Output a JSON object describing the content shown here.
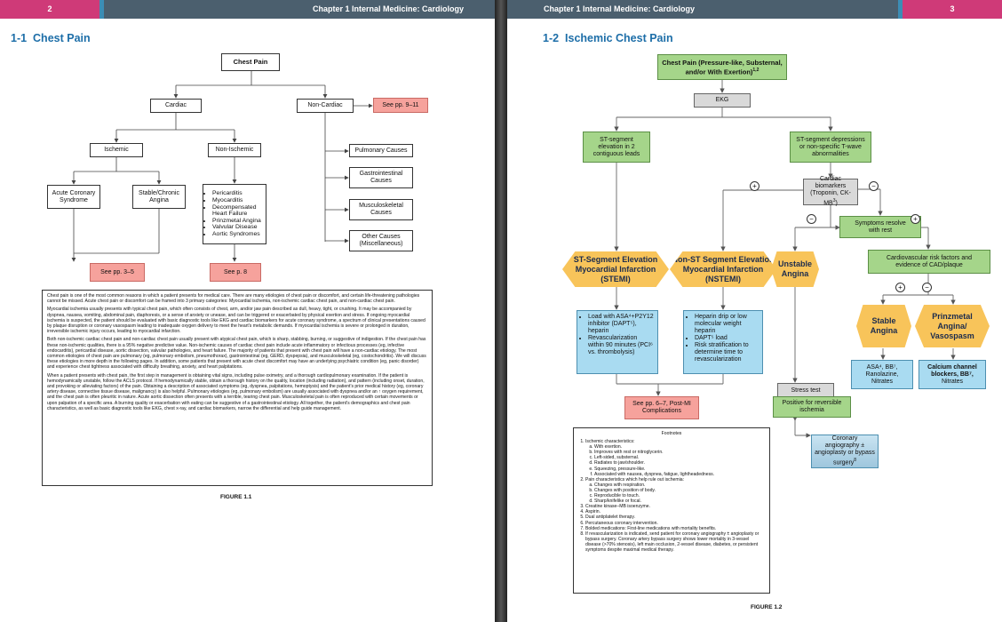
{
  "left_header": {
    "page_number": "2",
    "chapter": "Chapter 1  Internal Medicine: Cardiology"
  },
  "right_header": {
    "page_number": "3",
    "chapter": "Chapter 1  Internal Medicine: Cardiology"
  },
  "left": {
    "section_number": "1-1",
    "section_title": "Chest Pain",
    "nodes": {
      "chest_pain": "Chest Pain",
      "cardiac": "Cardiac",
      "non_cardiac": "Non-Cardiac",
      "see_9_11": "See pp. 9–11",
      "ischemic": "Ischemic",
      "non_ischemic": "Non-Ischemic",
      "acs": "Acute Coronary Syndrome",
      "stable_angina": "Stable/Chronic Angina",
      "non_ischemic_list": [
        "Pericarditis",
        "Myocarditis",
        "Decompensated Heart Failure",
        "Prinzmetal Angina",
        "Valvular Disease",
        "Aortic Syndromes"
      ],
      "pulmonary": "Pulmonary Causes",
      "gi": "Gastrointestinal Causes",
      "msk": "Musculoskeletal Causes",
      "other": "Other Causes (Miscellaneous)",
      "see_3_5": "See pp. 3–5",
      "see_8": "See p. 8"
    },
    "paragraphs": [
      "Chest pain is one of the most common reasons in which a patient presents for medical care. There are many etiologies of chest pain or discomfort, and certain life-threatening pathologies cannot be missed. Acute chest pain or discomfort can be framed into 3 primary categories: Myocardial ischemia, non-ischemic cardiac chest pain, and non-cardiac chest pain.",
      "Myocardial ischemia usually presents with typical chest pain, which often consists of chest, arm, and/or jaw pain described as dull, heavy, tight, or crushing. It may be accompanied by dyspnea, nausea, vomiting, abdominal pain, diaphoresis, or a sense of anxiety or unease, and can be triggered or exacerbated by physical exertion and stress. If ongoing myocardial ischemia is suspected, the patient should be evaluated with basic diagnostic tools like EKG and cardiac biomarkers for acute coronary syndrome, a spectrum of clinical presentations caused by plaque disruption or coronary vasospasm leading to inadequate oxygen delivery to meet the heart's metabolic demands. If myocardial ischemia is severe or prolonged in duration, irreversible ischemic injury occurs, leading to myocardial infarction.",
      "Both non-ischemic cardiac chest pain and non-cardiac chest pain usually present with atypical chest pain, which is sharp, stabbing, burning, or suggestive of indigestion. If the chest pain has these non-ischemic qualities, there is a 95% negative predictive value. Non-ischemic causes of cardiac chest pain include acute inflammatory or infectious processes (eg, infective endocarditis), pericardial disease, aortic dissection, valvular pathologies, and heart failure. The majority of patients that present with chest pain will have a non-cardiac etiology. The most common etiologies of chest pain are pulmonary (eg, pulmonary embolism, pneumothorax), gastrointestinal (eg, GERD, dyspepsia), and musculoskeletal (eg, costochondritis). We will discuss these etiologies in more depth in the following pages. In addition, some patients that present with acute chest discomfort may have an underlying psychiatric condition (eg, panic disorder) and experience chest tightness associated with difficulty breathing, anxiety, and heart palpitations.",
      "When a patient presents with chest pain, the first step in management is obtaining vital signs, including pulse oximetry, and a thorough cardiopulmonary examination. If the patient is hemodynamically unstable, follow the ACLS protocol. If hemodynamically stable, obtain a thorough history on the quality, location (including radiation), and pattern (including onset, duration, and provoking or alleviating factors) of the pain. Obtaining a description of associated symptoms (eg, dyspnea, palpitations, hemoptysis) and the patient's prior medical history (eg, coronary artery disease, connective tissue disease, malignancy) is also helpful. Pulmonary etiologies (eg, pulmonary embolism) are usually associated with dyspnea and/or an ↑ oxygen requirement, and the chest pain is often pleuritic in nature. Acute aortic dissection often presents with a terrible, tearing chest pain. Musculoskeletal pain is often reproduced with certain movements or upon palpation of a specific area. A burning quality or exacerbation with eating can be suggestive of a gastrointestinal etiology. All together, the patient's demographics and chest pain characteristics, as well as basic diagnostic tools like EKG, chest x-ray, and cardiac biomarkers, narrow the differential and help guide management."
    ],
    "figure_label": "FIGURE 1.1"
  },
  "right": {
    "section_number": "1-2",
    "section_title": "Ischemic Chest Pain",
    "nodes": {
      "top": "Chest Pain (Pressure-like, Substernal, and/or With Exertion)",
      "top_sup": "1,2",
      "ekg": "EKG",
      "st_elev": "ST-segment elevation in 2 contiguous leads",
      "st_dep": "ST-segment depressions or non-specific T-wave abnormalities",
      "biomarkers": "Cardiac biomarkers (Troponin, CK-MB",
      "biomarkers_sup": "3",
      "symptoms": "Symptoms resolve with rest",
      "cv_risk": "Cardiovascular risk factors and evidence of CAD/plaque",
      "stemi": "ST-Segment Elevation Myocardial Infarction (STEMI)",
      "nstemi": "Non-ST Segment Elevation Myocardial Infarction (NSTEMI)",
      "unstable": "Unstable Angina",
      "stable": "Stable Angina",
      "prinzmetal": "Prinzmetal Angina/ Vasospasm",
      "stemi_tx": [
        "Load with ASA⁴+P2Y12 inhibitor (DAPT⁵), heparin",
        "Revascularization within 90 minutes (PCI⁶ vs. thrombolysis)"
      ],
      "nstemi_tx": [
        "Heparin drip or low molecular weight heparin",
        "DAPT⁵ load",
        "Risk stratification to determine time to revascularization"
      ],
      "stable_tx": "ASA⁴, BB⁷, Ranolazine, Nitrates",
      "prinz_tx_bold": "Calcium channel blockers, BB⁷,",
      "prinz_tx": "Nitrates",
      "stress": "Stress test",
      "positive": "Positive for reversible ischemia",
      "angio": "Coronary angiography ± angioplasty or bypass surgery",
      "angio_sup": "8",
      "see_6_7": "See pp. 6–7, Post-MI Complications",
      "plus": "+",
      "minus": "−"
    },
    "footnotes_title": "Footnotes",
    "footnotes": [
      {
        "text": "Ischemic characteristics:",
        "sub": [
          "With exertion.",
          "Improves with rest or nitroglycerin.",
          "Left-sided, substernal.",
          "Radiates to jaw/shoulder.",
          "Squeezing, pressure-like.",
          "Associated with nausea, dyspnea, fatigue, lightheadedness."
        ]
      },
      {
        "text": "Pain characteristics which help rule out ischemia:",
        "sub": [
          "Changes with respiration.",
          "Changes with position of body.",
          "Reproducible to touch.",
          "Sharp/knifelike or focal."
        ]
      },
      {
        "text": "Creatine kinase–MB isoenzyme.",
        "sub": []
      },
      {
        "text": "Aspirin.",
        "sub": []
      },
      {
        "text": "Dual antiplatelet therapy.",
        "sub": []
      },
      {
        "text": "Percutaneous coronary intervention.",
        "sub": []
      },
      {
        "text": "Bolded medications: First-line medications with mortality benefits.",
        "sub": []
      },
      {
        "text": "If revascularization is indicated, send patient for coronary angiography ± angioplasty or bypass surgery. Coronary artery bypass surgery shows lower mortality in 3-vessel disease (>70% stenosis), left main occlusion, 2-vessel disease, diabetes, or persistent symptoms despite maximal medical therapy.",
        "sub": []
      }
    ],
    "figure_label": "FIGURE 1.2"
  }
}
